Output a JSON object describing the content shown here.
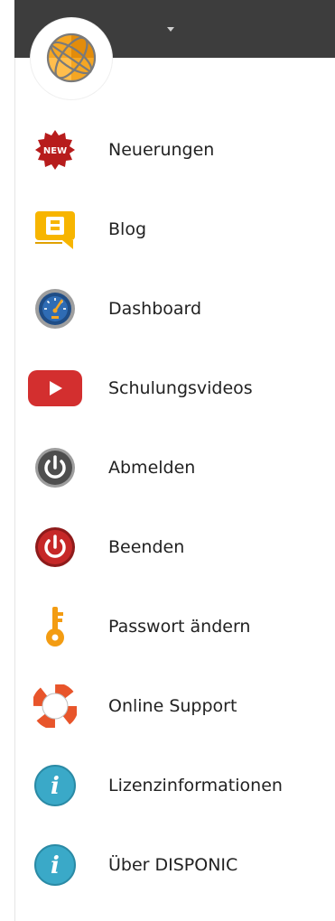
{
  "menu": {
    "items": [
      {
        "label": "Neuerungen",
        "icon": "new-badge-icon"
      },
      {
        "label": "Blog",
        "icon": "blog-b-icon"
      },
      {
        "label": "Dashboard",
        "icon": "speedometer-icon"
      },
      {
        "label": "Schulungsvideos",
        "icon": "video-play-icon"
      },
      {
        "label": "Abmelden",
        "icon": "power-gray-icon"
      },
      {
        "label": "Beenden",
        "icon": "power-red-icon"
      },
      {
        "label": "Passwort ändern",
        "icon": "key-icon"
      },
      {
        "label": "Online Support",
        "icon": "lifebuoy-icon"
      },
      {
        "label": "Lizenzinformationen",
        "icon": "info-icon"
      },
      {
        "label": "Über DISPONIC",
        "icon": "info-icon"
      }
    ]
  },
  "badge": {
    "new_text": "NEW"
  },
  "colors": {
    "topbar": "#3d3d3d",
    "logo_orange": "#f5a623",
    "red": "#c62828",
    "blog_yellow": "#f7b500",
    "info_teal": "#3aa9c8"
  }
}
